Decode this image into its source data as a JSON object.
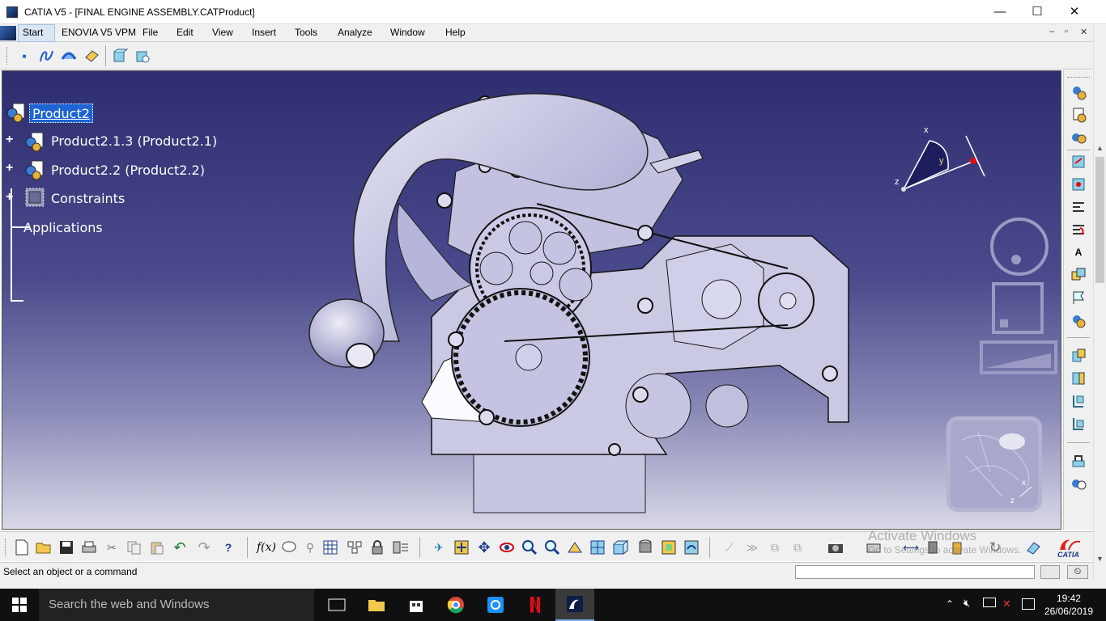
{
  "window": {
    "title": "CATIA V5 - [FINAL ENGINE ASSEMBLY.CATProduct]",
    "minimize": "—",
    "maximize": "☐",
    "close": "✕"
  },
  "menu": {
    "items": [
      "Start",
      "ENOVIA V5 VPM",
      "File",
      "Edit",
      "View",
      "Insert",
      "Tools",
      "Analyze",
      "Window",
      "Help"
    ],
    "mdi_min": "–",
    "mdi_restore": "▫",
    "mdi_close": "✕"
  },
  "tree": {
    "root": "Product2",
    "children": [
      "Product2.1.3 (Product2.1)",
      "Product2.2 (Product2.2)",
      "Constraints"
    ],
    "applications": "Applications"
  },
  "compass": {
    "x": "x",
    "y": "y",
    "z": "z"
  },
  "minimap": {
    "x": "x",
    "z": "z"
  },
  "status": {
    "message": "Select an object or a command"
  },
  "watermark": {
    "line1": "Activate Windows",
    "line2": "Go to Settings to activate Windows."
  },
  "catia_logo": "CATIA",
  "taskbar": {
    "search_placeholder": "Search the web and Windows",
    "time": "19:42",
    "date": "26/06/2019"
  },
  "colors": {
    "viewport_top": "#2d2d70",
    "viewport_bottom": "#d8d8e8",
    "part_fill": "#c9c9e4",
    "selection": "#1e64d2"
  }
}
